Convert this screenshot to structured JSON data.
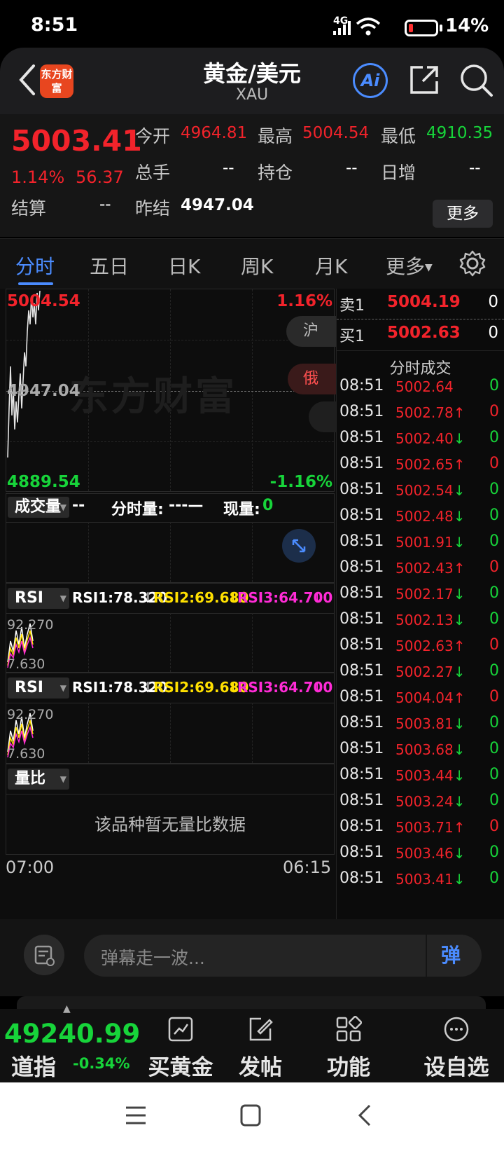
{
  "status": {
    "time": "8:51",
    "network": "4G",
    "battery_pct": "14%",
    "battery_level": 0.14
  },
  "header": {
    "logo_text": "东方财富",
    "title": "黄金/美元",
    "subtitle": "XAU",
    "ai_label": "Ai"
  },
  "quote": {
    "price": "5003.41",
    "change_pct": "1.14%",
    "change": "56.37",
    "open_label": "今开",
    "open": "4964.81",
    "high_label": "最高",
    "high": "5004.54",
    "low_label": "最低",
    "low": "4910.35",
    "volume_label": "总手",
    "volume": "--",
    "position_label": "持仓",
    "position": "--",
    "daily_inc_label": "日增",
    "daily_inc": "--",
    "settle_label": "结算",
    "settle": "--",
    "prev_settle_label": "昨结",
    "prev_settle": "4947.04",
    "more_button": "更多"
  },
  "tabs": {
    "items": [
      "分时",
      "五日",
      "日K",
      "周K",
      "月K",
      "更多"
    ],
    "active": "分时"
  },
  "intraday": {
    "max_price": "5004.54",
    "max_pct": "1.16%",
    "ref_price": "4947.04",
    "min_price": "4889.54",
    "min_pct": "-1.16%",
    "watermark": "东方财富",
    "badge_hu": "沪",
    "badge_e": "俄",
    "start_time": "07:00",
    "end_time": "06:15"
  },
  "volume_panel": {
    "selector": "成交量",
    "value": "--",
    "minute_label": "分时量:",
    "minute_value": "---—",
    "now_label": "现量:",
    "now_value": "0"
  },
  "rsi_panels": [
    {
      "selector": "RSI",
      "rsi1": "RSI1:78.320",
      "rsi2": "RSI2:69.680",
      "rsi3": "RSI3:64.700",
      "top": "92.270",
      "bottom": "7.630"
    },
    {
      "selector": "RSI",
      "rsi1": "RSI1:78.320",
      "rsi2": "RSI2:69.680",
      "rsi3": "RSI3:64.700",
      "top": "92.270",
      "bottom": "7.630"
    }
  ],
  "ratio_panel": {
    "selector": "量比",
    "empty_text": "该品种暂无量比数据"
  },
  "orderbook": {
    "ask_label": "卖1",
    "ask_price": "5004.19",
    "ask_qty": "0",
    "bid_label": "买1",
    "bid_price": "5002.63",
    "bid_qty": "0",
    "ticks_title": "分时成交"
  },
  "ticks": [
    {
      "time": "08:51",
      "price": "5002.64",
      "dir": "",
      "qty": "0",
      "qcolor": "green"
    },
    {
      "time": "08:51",
      "price": "5002.78",
      "dir": "↑",
      "qty": "0",
      "qcolor": "red"
    },
    {
      "time": "08:51",
      "price": "5002.40",
      "dir": "↓",
      "qty": "0",
      "qcolor": "green"
    },
    {
      "time": "08:51",
      "price": "5002.65",
      "dir": "↑",
      "qty": "0",
      "qcolor": "red"
    },
    {
      "time": "08:51",
      "price": "5002.54",
      "dir": "↓",
      "qty": "0",
      "qcolor": "green"
    },
    {
      "time": "08:51",
      "price": "5002.48",
      "dir": "↓",
      "qty": "0",
      "qcolor": "green"
    },
    {
      "time": "08:51",
      "price": "5001.91",
      "dir": "↓",
      "qty": "0",
      "qcolor": "green"
    },
    {
      "time": "08:51",
      "price": "5002.43",
      "dir": "↑",
      "qty": "0",
      "qcolor": "red"
    },
    {
      "time": "08:51",
      "price": "5002.17",
      "dir": "↓",
      "qty": "0",
      "qcolor": "green"
    },
    {
      "time": "08:51",
      "price": "5002.13",
      "dir": "↓",
      "qty": "0",
      "qcolor": "green"
    },
    {
      "time": "08:51",
      "price": "5002.63",
      "dir": "↑",
      "qty": "0",
      "qcolor": "red"
    },
    {
      "time": "08:51",
      "price": "5002.27",
      "dir": "↓",
      "qty": "0",
      "qcolor": "green"
    },
    {
      "time": "08:51",
      "price": "5004.04",
      "dir": "↑",
      "qty": "0",
      "qcolor": "red"
    },
    {
      "time": "08:51",
      "price": "5003.81",
      "dir": "↓",
      "qty": "0",
      "qcolor": "green"
    },
    {
      "time": "08:51",
      "price": "5003.68",
      "dir": "↓",
      "qty": "0",
      "qcolor": "green"
    },
    {
      "time": "08:51",
      "price": "5003.44",
      "dir": "↓",
      "qty": "0",
      "qcolor": "green"
    },
    {
      "time": "08:51",
      "price": "5003.24",
      "dir": "↓",
      "qty": "0",
      "qcolor": "green"
    },
    {
      "time": "08:51",
      "price": "5003.71",
      "dir": "↑",
      "qty": "0",
      "qcolor": "red"
    },
    {
      "time": "08:51",
      "price": "5003.46",
      "dir": "↓",
      "qty": "0",
      "qcolor": "green"
    },
    {
      "time": "08:51",
      "price": "5003.41",
      "dir": "↓",
      "qty": "0",
      "qcolor": "green"
    }
  ],
  "danmu": {
    "placeholder": "弹幕走一波...",
    "send_label": "弹"
  },
  "bottom_nav": {
    "index_value": "49240.99",
    "index_name": "道指",
    "index_change": "-0.34%",
    "items": [
      "买黄金",
      "发帖",
      "功能",
      "设自选"
    ]
  },
  "colors": {
    "up": "#f2232b",
    "down": "#17d43a",
    "accent": "#4b8cff",
    "rsi2": "#ffe000",
    "rsi3": "#ff2bd6"
  }
}
